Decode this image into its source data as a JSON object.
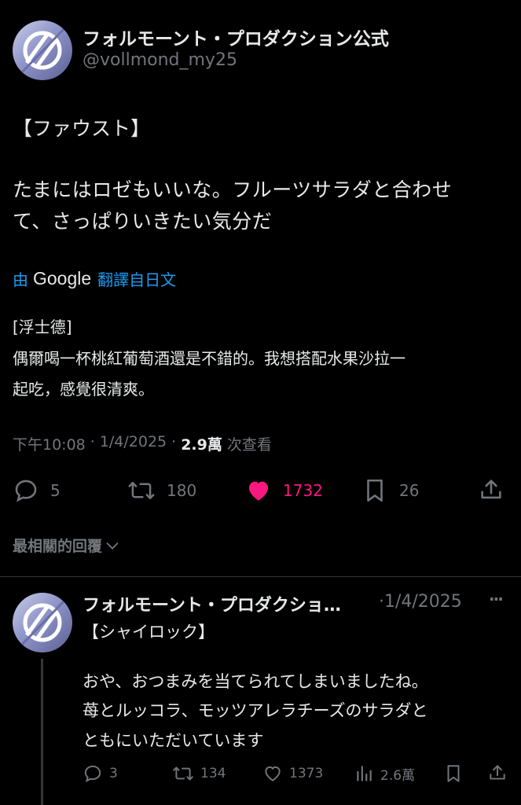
{
  "main_tweet": {
    "display_name": "フォルモーント・プロダクション公式",
    "handle": "@vollmond_my25",
    "text_line1": "【ファウスト】",
    "text_line2": "たまにはロゼもいいな。フルーツサラダと合わせ",
    "text_line3": "て、さっぱりいきたい気分だ",
    "translation": {
      "by": "由",
      "brand": "Google",
      "label": "翻譯自日文",
      "line1": "[浮士德]",
      "line2": "偶爾喝一杯桃紅葡萄酒還是不錯的。我想搭配水果沙拉一",
      "line3": "起吃，感覺很清爽。"
    },
    "meta": {
      "time": "下午10:08",
      "sep1": "·",
      "date": "1/4/2025",
      "sep2": "·",
      "views": "2.9萬",
      "views_label": "次查看"
    },
    "actions": {
      "replies": "5",
      "retweets": "180",
      "likes": "1732",
      "bookmarks": "26"
    },
    "like_color": "#f91880"
  },
  "replies_sort": {
    "label": "最相關的回覆"
  },
  "reply_tweet": {
    "display_name": "フォルモーント・プロダクショ…",
    "date": "·1/4/2025",
    "more": "···",
    "line0": "【シャイロック】",
    "line1": "おや、おつまみを当てられてしまいましたね。",
    "line2": "苺とルッコラ、モッツアレラチーズのサラダと",
    "line3": "ともにいただいています",
    "actions": {
      "replies": "3",
      "retweets": "134",
      "likes": "1373",
      "views": "2.6萬"
    }
  },
  "colors": {
    "background": "#000000",
    "text": "#e7e9ea",
    "muted": "#71767b",
    "link": "#1d9bf0",
    "like": "#f91880"
  }
}
